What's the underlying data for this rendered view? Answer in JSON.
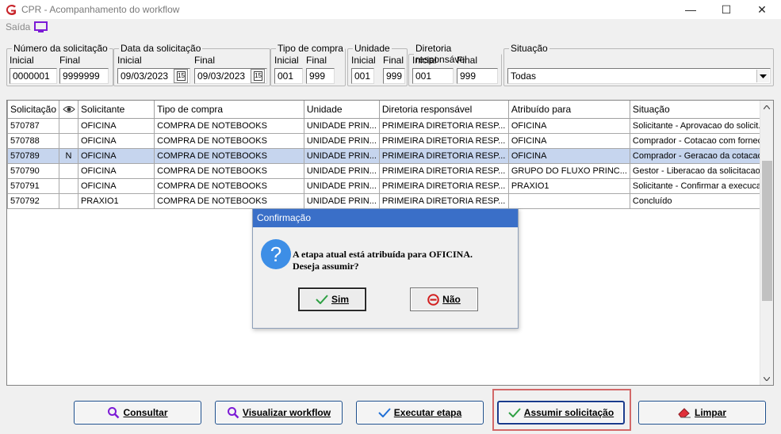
{
  "window": {
    "title": "CPR - Acompanhamento do workflow",
    "minimize_glyph": "—",
    "maximize_glyph": "☐",
    "close_glyph": "✕"
  },
  "menu": {
    "saida": "Saída",
    "monitor_icon": "monitor-icon"
  },
  "filters": {
    "numero": {
      "legend": "Número da solicitação",
      "inicial_label": "Inicial",
      "final_label": "Final",
      "inicial": "0000001",
      "final": "9999999"
    },
    "data": {
      "legend": "Data da solicitação",
      "inicial_label": "Inicial",
      "final_label": "Final",
      "inicial": "09/03/2023",
      "final": "09/03/2023",
      "cal_icon": "15"
    },
    "tipo": {
      "legend": "Tipo de compra",
      "inicial_label": "Inicial",
      "final_label": "Final",
      "inicial": "001",
      "final": "999"
    },
    "unidade": {
      "legend": "Unidade",
      "inicial_label": "Inicial",
      "final_label": "Final",
      "inicial": "001",
      "final": "999"
    },
    "diretoria": {
      "legend": "Diretoria responsável",
      "inicial_label": "Inicial",
      "final_label": "Final",
      "inicial": "001",
      "final": "999"
    },
    "situacao": {
      "legend": "Situação",
      "value": "Todas"
    }
  },
  "grid": {
    "columns": [
      "Solicitação",
      "",
      "Solicitante",
      "Tipo de compra",
      "Unidade",
      "Diretoria responsável",
      "Atribuído para",
      "Situação"
    ],
    "rows": [
      [
        "570787",
        "",
        "OFICINA",
        "COMPRA DE NOTEBOOKS",
        "UNIDADE PRIN...",
        "PRIMEIRA DIRETORIA RESP...",
        "OFICINA",
        "Solicitante - Aprovacao do solicit..."
      ],
      [
        "570788",
        "",
        "OFICINA",
        "COMPRA DE NOTEBOOKS",
        "UNIDADE PRIN...",
        "PRIMEIRA DIRETORIA RESP...",
        "OFICINA",
        "Comprador - Cotacao com fornec..."
      ],
      [
        "570789",
        "N",
        "OFICINA",
        "COMPRA DE NOTEBOOKS",
        "UNIDADE PRIN...",
        "PRIMEIRA DIRETORIA RESP...",
        "OFICINA",
        "Comprador - Geracao da cotacao"
      ],
      [
        "570790",
        "",
        "OFICINA",
        "COMPRA DE NOTEBOOKS",
        "UNIDADE PRIN...",
        "PRIMEIRA DIRETORIA RESP...",
        "GRUPO DO FLUXO PRINC...",
        "Gestor - Liberacao da solicitacao ..."
      ],
      [
        "570791",
        "",
        "OFICINA",
        "COMPRA DE NOTEBOOKS",
        "UNIDADE PRIN...",
        "PRIMEIRA DIRETORIA RESP...",
        "PRAXIO1",
        "Solicitante - Confirmar a execuca..."
      ],
      [
        "570792",
        "",
        "PRAXIO1",
        "COMPRA DE NOTEBOOKS",
        "UNIDADE PRIN...",
        "PRIMEIRA DIRETORIA RESP...",
        "",
        "Concluído"
      ]
    ],
    "selected_row": 2
  },
  "dialog": {
    "title": "Confirmação",
    "message": "A etapa atual está atribuída para OFICINA.\nDeseja assumir?",
    "icon": "?",
    "yes": "Sim",
    "no": "Não"
  },
  "buttons": {
    "consultar": "Consultar",
    "visualizar": "Visualizar workflow",
    "executar": "Executar etapa",
    "assumir": "Assumir solicitação",
    "limpar": "Limpar"
  },
  "colors": {
    "selected_row": "#c6d5ee",
    "dialog_title": "#3a6fc8",
    "highlight": "#d26868",
    "accent_purple": "#7c1bd6"
  }
}
